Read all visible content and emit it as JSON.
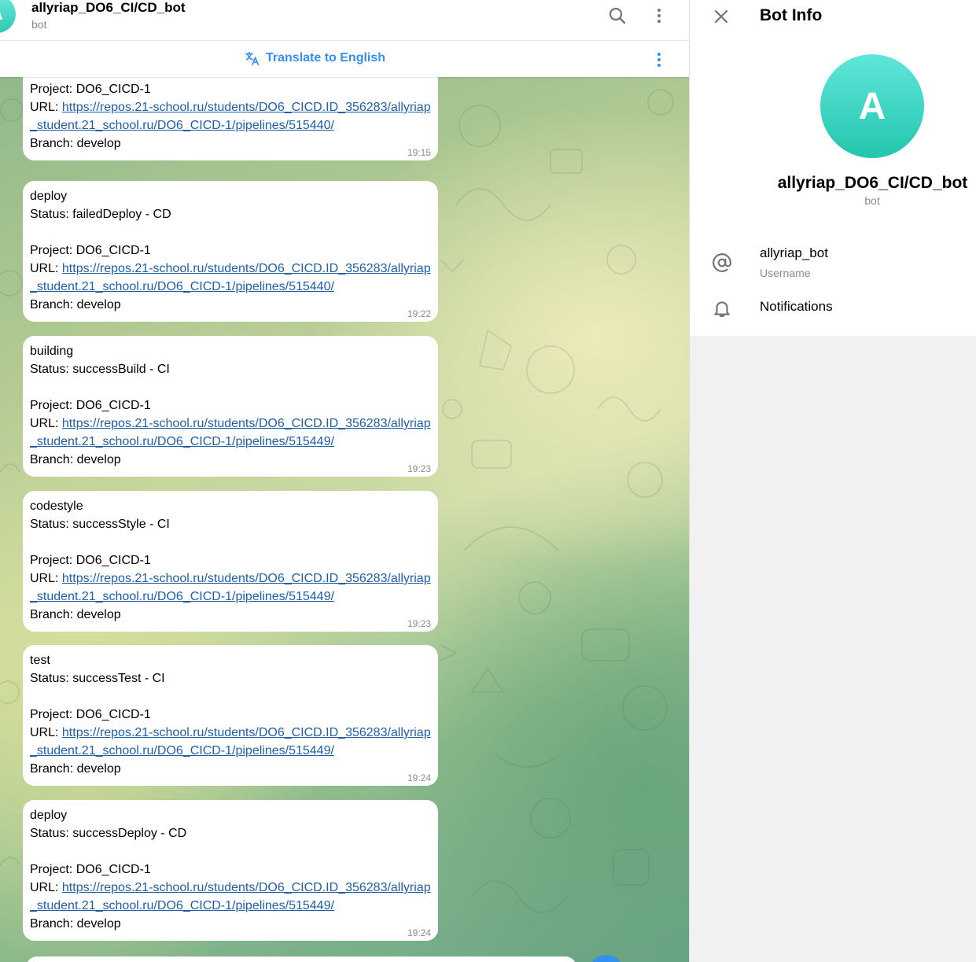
{
  "header": {
    "avatar_letter": "A",
    "title": "allyriap_DO6_CI/CD_bot",
    "subtitle": "bot",
    "icons": [
      "search-icon",
      "more-vertical-icon"
    ]
  },
  "translate_bar": {
    "label": "Translate to English",
    "icon": "translate-icon"
  },
  "messages": [
    {
      "lines": [
        "Project: DO6_CICD-1"
      ],
      "url_prefix": "URL: ",
      "url": "https://repos.21-school.ru/students/DO6_CICD.ID_356283/allyriap_student.21_school.ru/DO6_CICD-1/pipelines/515440/",
      "branch": "Branch: develop",
      "time": "19:15"
    },
    {
      "lines": [
        "deploy",
        "Status: failedDeploy - CD",
        "",
        "Project: DO6_CICD-1"
      ],
      "url_prefix": "URL: ",
      "url": "https://repos.21-school.ru/students/DO6_CICD.ID_356283/allyriap_student.21_school.ru/DO6_CICD-1/pipelines/515440/",
      "branch": "Branch: develop",
      "time": "19:22"
    },
    {
      "lines": [
        "building",
        "Status: successBuild - CI",
        "",
        "Project: DO6_CICD-1"
      ],
      "url_prefix": "URL: ",
      "url": "https://repos.21-school.ru/students/DO6_CICD.ID_356283/allyriap_student.21_school.ru/DO6_CICD-1/pipelines/515449/",
      "branch": "Branch: develop",
      "time": "19:23"
    },
    {
      "lines": [
        "codestyle",
        "Status: successStyle - CI",
        "",
        "Project: DO6_CICD-1"
      ],
      "url_prefix": "URL: ",
      "url": "https://repos.21-school.ru/students/DO6_CICD.ID_356283/allyriap_student.21_school.ru/DO6_CICD-1/pipelines/515449/",
      "branch": "Branch: develop",
      "time": "19:23"
    },
    {
      "lines": [
        "test",
        "Status: successTest - CI",
        "",
        "Project: DO6_CICD-1"
      ],
      "url_prefix": "URL: ",
      "url": "https://repos.21-school.ru/students/DO6_CICD.ID_356283/allyriap_student.21_school.ru/DO6_CICD-1/pipelines/515449/",
      "branch": "Branch: develop",
      "time": "19:24"
    },
    {
      "lines": [
        "deploy",
        "Status: successDeploy - CD",
        "",
        "Project: DO6_CICD-1"
      ],
      "url_prefix": "URL: ",
      "url": "https://repos.21-school.ru/students/DO6_CICD.ID_356283/allyriap_student.21_school.ru/DO6_CICD-1/pipelines/515449/",
      "branch": "Branch: develop",
      "time": "19:24"
    }
  ],
  "info_panel": {
    "title": "Bot Info",
    "avatar_letter": "A",
    "name": "allyriap_DO6_CI/CD_bot",
    "name_sub": "bot",
    "username": "allyriap_bot",
    "username_label": "Username",
    "notifications_label": "Notifications",
    "icons": [
      "close-icon",
      "at-sign-icon",
      "bell-icon"
    ]
  },
  "colors": {
    "accent": "#3390ec",
    "link": "#1e5fa8",
    "avatar": "#2bcab2",
    "muted": "#8a8a8a"
  }
}
